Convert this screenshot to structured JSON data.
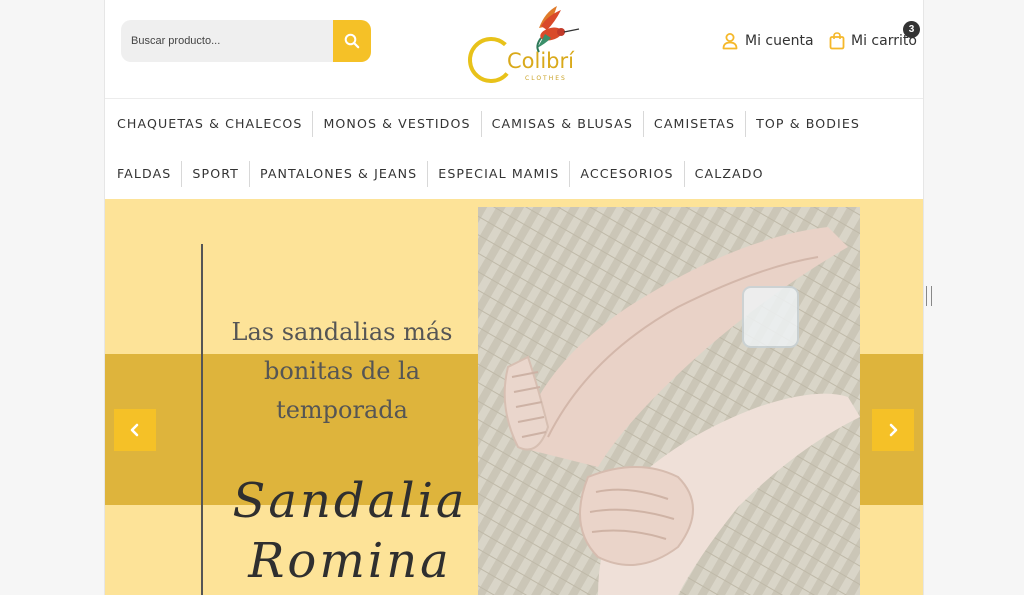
{
  "header": {
    "search": {
      "placeholder": "Buscar producto...",
      "icon": "search-icon"
    },
    "logo": {
      "brand": "Colibrí",
      "tagline": "CLOTHES"
    },
    "account": {
      "label": "Mi cuenta",
      "icon": "user-icon"
    },
    "cart": {
      "label": "Mi carrito",
      "icon": "shopping-bag-icon",
      "count": "3"
    }
  },
  "nav": {
    "row1": [
      "CHAQUETAS & CHALECOS",
      "MONOS & VESTIDOS",
      "CAMISAS & BLUSAS",
      "CAMISETAS",
      "TOP & BODIES"
    ],
    "row2": [
      "FALDAS",
      "SPORT",
      "PANTALONES & JEANS",
      "ESPECIAL MAMIS",
      "ACCESORIOS",
      "CALZADO"
    ]
  },
  "slider": {
    "headline_line1": "Las sandalias más",
    "headline_line2": "bonitas de la",
    "headline_line3": "temporada",
    "script_line1": "Sandalia",
    "script_line2": "Romina",
    "prev_icon": "chevron-left-icon",
    "next_icon": "chevron-right-icon",
    "colors": {
      "light": "#fde398",
      "band": "#deb43c",
      "accent": "#f5c127"
    }
  }
}
